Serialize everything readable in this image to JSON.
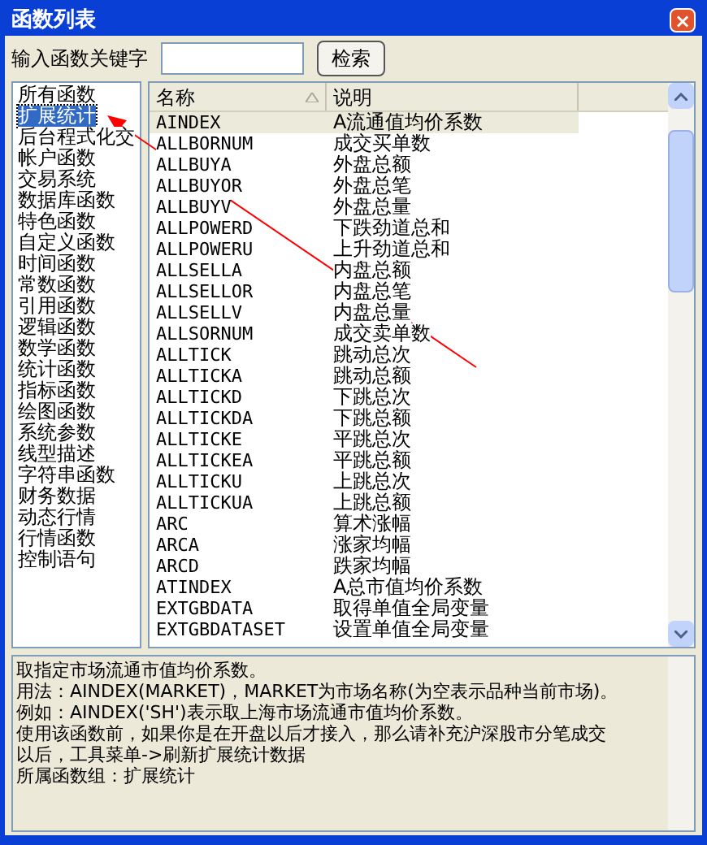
{
  "window": {
    "title": "函数列表",
    "close": "×"
  },
  "search": {
    "label": "输入函数关键字",
    "button": "检索"
  },
  "groups": [
    {
      "label": "所有函数",
      "selected": false
    },
    {
      "label": "扩展统计",
      "selected": true
    },
    {
      "label": "后台程式化交",
      "selected": false
    },
    {
      "label": "帐户函数",
      "selected": false
    },
    {
      "label": "交易系统",
      "selected": false
    },
    {
      "label": "数据库函数",
      "selected": false
    },
    {
      "label": "特色函数",
      "selected": false
    },
    {
      "label": "自定义函数",
      "selected": false
    },
    {
      "label": "时间函数",
      "selected": false
    },
    {
      "label": "常数函数",
      "selected": false
    },
    {
      "label": "引用函数",
      "selected": false
    },
    {
      "label": "逻辑函数",
      "selected": false
    },
    {
      "label": "数学函数",
      "selected": false
    },
    {
      "label": "统计函数",
      "selected": false
    },
    {
      "label": "指标函数",
      "selected": false
    },
    {
      "label": "绘图函数",
      "selected": false
    },
    {
      "label": "系统参数",
      "selected": false
    },
    {
      "label": "线型描述",
      "selected": false
    },
    {
      "label": "字符串函数",
      "selected": false
    },
    {
      "label": "财务数据",
      "selected": false
    },
    {
      "label": "动态行情",
      "selected": false
    },
    {
      "label": "行情函数",
      "selected": false
    },
    {
      "label": "控制语句",
      "selected": false
    }
  ],
  "table": {
    "columns": [
      "名称",
      "说明"
    ],
    "rows": [
      {
        "name": "AINDEX",
        "desc": "A流通值均价系数",
        "selected": true
      },
      {
        "name": "ALLBORNUM",
        "desc": "成交买单数",
        "selected": false
      },
      {
        "name": "ALLBUYA",
        "desc": "外盘总额",
        "selected": false
      },
      {
        "name": "ALLBUYOR",
        "desc": "外盘总笔",
        "selected": false
      },
      {
        "name": "ALLBUYV",
        "desc": "外盘总量",
        "selected": false
      },
      {
        "name": "ALLPOWERD",
        "desc": "下跌劲道总和",
        "selected": false
      },
      {
        "name": "ALLPOWERU",
        "desc": "上升劲道总和",
        "selected": false
      },
      {
        "name": "ALLSELLA",
        "desc": "内盘总额",
        "selected": false
      },
      {
        "name": "ALLSELLOR",
        "desc": "内盘总笔",
        "selected": false
      },
      {
        "name": "ALLSELLV",
        "desc": "内盘总量",
        "selected": false
      },
      {
        "name": "ALLSORNUM",
        "desc": "成交卖单数",
        "selected": false
      },
      {
        "name": "ALLTICK",
        "desc": "跳动总次",
        "selected": false
      },
      {
        "name": "ALLTICKA",
        "desc": "跳动总额",
        "selected": false
      },
      {
        "name": "ALLTICKD",
        "desc": "下跳总次",
        "selected": false
      },
      {
        "name": "ALLTICKDA",
        "desc": "下跳总额",
        "selected": false
      },
      {
        "name": "ALLTICKE",
        "desc": "平跳总次",
        "selected": false
      },
      {
        "name": "ALLTICKEA",
        "desc": "平跳总额",
        "selected": false
      },
      {
        "name": "ALLTICKU",
        "desc": "上跳总次",
        "selected": false
      },
      {
        "name": "ALLTICKUA",
        "desc": "上跳总额",
        "selected": false
      },
      {
        "name": "ARC",
        "desc": "算术涨幅",
        "selected": false
      },
      {
        "name": "ARCA",
        "desc": "涨家均幅",
        "selected": false
      },
      {
        "name": "ARCD",
        "desc": "跌家均幅",
        "selected": false
      },
      {
        "name": "ATINDEX",
        "desc": "A总市值均价系数",
        "selected": false
      },
      {
        "name": "EXTGBDATA",
        "desc": "取得单值全局变量",
        "selected": false
      },
      {
        "name": "EXTGBDATASET",
        "desc": "设置单值全局变量",
        "selected": false
      }
    ]
  },
  "description": [
    "取指定市场流通市值均价系数。",
    "用法：AINDEX(MARKET)，MARKET为市场名称(为空表示品种当前市场)。",
    "例如：AINDEX('SH')表示取上海市场流通市值均价系数。",
    "使用该函数前，如果你是在开盘以后才接入，那么请补充沪深股市分笔成交",
    "以后，工具菜单->刷新扩展统计数据",
    "所属函数组：扩展统计"
  ]
}
